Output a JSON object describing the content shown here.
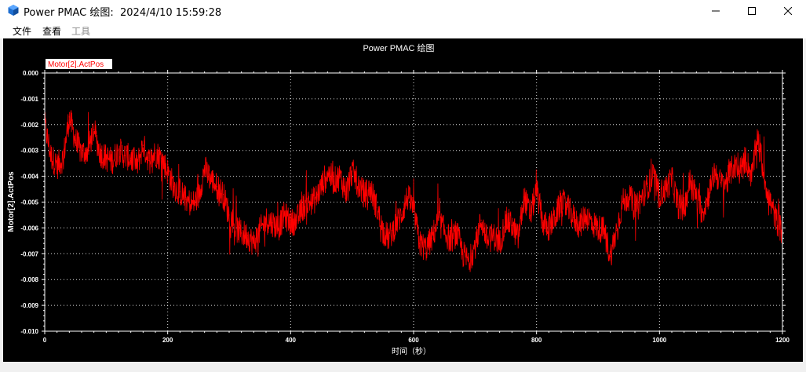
{
  "window": {
    "title": "Power PMAC 绘图:  2024/4/10 15:59:28",
    "icon": "cube-app-icon",
    "controls": [
      "minimize-icon",
      "maximize-icon",
      "close-icon"
    ]
  },
  "menu": {
    "file": "文件",
    "view": "查看",
    "tools": "工具"
  },
  "colors": {
    "background": "#000000",
    "series": "#ff0000",
    "axis": "#ffffff",
    "grid": "#ffffff"
  },
  "chart_data": {
    "type": "line",
    "title": "Power PMAC 绘图",
    "xlabel": "时间（秒）",
    "ylabel": "Motor[2].ActPos",
    "xlim": [
      0,
      1200
    ],
    "ylim": [
      -0.01,
      0.0
    ],
    "x_ticks": [
      "0",
      "200",
      "400",
      "600",
      "800",
      "1000",
      "1200"
    ],
    "y_ticks": [
      "0.000",
      "-0.001",
      "-0.002",
      "-0.003",
      "-0.004",
      "-0.005",
      "-0.006",
      "-0.007",
      "-0.008",
      "-0.009",
      "-0.010"
    ],
    "grid": true,
    "grid_style": "dotted",
    "legend_position": "top-left",
    "series": [
      {
        "name": "Motor[2].ActPos",
        "color": "#ff0000",
        "x": [
          0,
          10,
          20,
          30,
          40,
          50,
          60,
          70,
          80,
          90,
          100,
          110,
          120,
          130,
          140,
          150,
          160,
          170,
          180,
          190,
          200,
          210,
          220,
          230,
          240,
          250,
          260,
          270,
          280,
          290,
          300,
          310,
          320,
          330,
          340,
          350,
          360,
          370,
          380,
          390,
          400,
          410,
          420,
          430,
          440,
          450,
          460,
          470,
          480,
          490,
          500,
          510,
          520,
          530,
          540,
          550,
          560,
          570,
          580,
          590,
          600,
          610,
          620,
          630,
          640,
          650,
          660,
          670,
          680,
          690,
          700,
          710,
          720,
          730,
          740,
          750,
          760,
          770,
          780,
          790,
          800,
          810,
          820,
          830,
          840,
          850,
          860,
          870,
          880,
          890,
          900,
          910,
          920,
          930,
          940,
          950,
          960,
          970,
          980,
          990,
          1000,
          1010,
          1020,
          1030,
          1040,
          1050,
          1060,
          1070,
          1080,
          1090,
          1100,
          1110,
          1120,
          1130,
          1140,
          1150,
          1160,
          1170,
          1180,
          1190,
          1200
        ],
        "y": [
          -0.002,
          -0.0032,
          -0.0036,
          -0.0033,
          -0.0017,
          -0.0026,
          -0.0031,
          -0.003,
          -0.0022,
          -0.0031,
          -0.0033,
          -0.0034,
          -0.003,
          -0.0032,
          -0.0033,
          -0.0036,
          -0.0028,
          -0.0034,
          -0.0031,
          -0.0033,
          -0.0038,
          -0.0044,
          -0.0046,
          -0.0049,
          -0.0051,
          -0.0048,
          -0.0037,
          -0.0041,
          -0.0044,
          -0.0047,
          -0.0055,
          -0.006,
          -0.0062,
          -0.0063,
          -0.0066,
          -0.0061,
          -0.0057,
          -0.0058,
          -0.006,
          -0.0055,
          -0.0058,
          -0.0057,
          -0.0052,
          -0.005,
          -0.0049,
          -0.0044,
          -0.0038,
          -0.0042,
          -0.004,
          -0.0046,
          -0.0038,
          -0.0043,
          -0.0047,
          -0.0045,
          -0.0052,
          -0.0061,
          -0.0064,
          -0.0059,
          -0.0055,
          -0.0048,
          -0.0053,
          -0.0066,
          -0.0068,
          -0.0064,
          -0.0057,
          -0.0061,
          -0.0065,
          -0.0062,
          -0.007,
          -0.0073,
          -0.0067,
          -0.0057,
          -0.0065,
          -0.0063,
          -0.0066,
          -0.0057,
          -0.0059,
          -0.0064,
          -0.0048,
          -0.0055,
          -0.0045,
          -0.0058,
          -0.006,
          -0.0056,
          -0.005,
          -0.0052,
          -0.0056,
          -0.0059,
          -0.0055,
          -0.0058,
          -0.006,
          -0.0061,
          -0.0071,
          -0.0061,
          -0.005,
          -0.0048,
          -0.0051,
          -0.0049,
          -0.0044,
          -0.004,
          -0.0047,
          -0.0045,
          -0.0041,
          -0.0051,
          -0.0053,
          -0.0041,
          -0.0048,
          -0.0054,
          -0.0047,
          -0.0038,
          -0.0043,
          -0.0042,
          -0.0036,
          -0.0038,
          -0.0033,
          -0.004,
          -0.0024,
          -0.004,
          -0.005,
          -0.0057,
          -0.0062
        ]
      }
    ]
  }
}
